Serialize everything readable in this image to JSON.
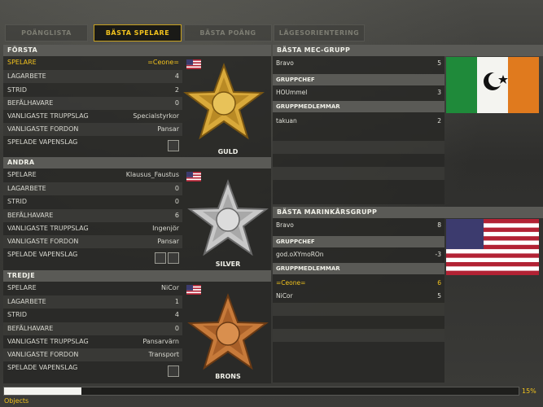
{
  "tabs": [
    {
      "label": "POÄNGLISTA",
      "active": false
    },
    {
      "label": "BÄSTA SPELARE",
      "active": true
    },
    {
      "label": "BÄSTA POÄNG",
      "active": false
    },
    {
      "label": "LÄGESORIENTERING",
      "active": false
    }
  ],
  "places": [
    {
      "title": "FÖRSTA",
      "rows": [
        {
          "k": "SPELARE",
          "v": "=Ceone=",
          "hl": true
        },
        {
          "k": "LAGARBETE",
          "v": "4"
        },
        {
          "k": "STRID",
          "v": "2"
        },
        {
          "k": "BEFÄLHAVARE",
          "v": "0"
        },
        {
          "k": "VANLIGASTE TRUPPSLAG",
          "v": "Specialstyrkor"
        },
        {
          "k": "VANLIGASTE FORDON",
          "v": "Pansar"
        },
        {
          "k": "SPELADE VAPENSLAG",
          "v": ""
        }
      ],
      "medal": "GULD",
      "medal_color": "#d9a93a"
    },
    {
      "title": "ANDRA",
      "rows": [
        {
          "k": "SPELARE",
          "v": "Klausus_Faustus"
        },
        {
          "k": "LAGARBETE",
          "v": "0"
        },
        {
          "k": "STRID",
          "v": "0"
        },
        {
          "k": "BEFÄLHAVARE",
          "v": "6"
        },
        {
          "k": "VANLIGASTE TRUPPSLAG",
          "v": "Ingenjör"
        },
        {
          "k": "VANLIGASTE FORDON",
          "v": "Pansar"
        },
        {
          "k": "SPELADE VAPENSLAG",
          "v": ""
        }
      ],
      "medal": "SILVER",
      "medal_color": "#c8c8c8"
    },
    {
      "title": "TREDJE",
      "rows": [
        {
          "k": "SPELARE",
          "v": "NiCor"
        },
        {
          "k": "LAGARBETE",
          "v": "1"
        },
        {
          "k": "STRID",
          "v": "4"
        },
        {
          "k": "BEFÄLHAVARE",
          "v": "0"
        },
        {
          "k": "VANLIGASTE TRUPPSLAG",
          "v": "Pansarvärn"
        },
        {
          "k": "VANLIGASTE FORDON",
          "v": "Transport"
        },
        {
          "k": "SPELADE VAPENSLAG",
          "v": ""
        }
      ],
      "medal": "BRONS",
      "medal_color": "#c77a3a"
    }
  ],
  "mec": {
    "title": "BÄSTA MEC-GRUPP",
    "squad": {
      "name": "Bravo",
      "val": "5"
    },
    "chef_label": "GRUPPCHEF",
    "chef": {
      "name": "HOUmmel",
      "val": "3"
    },
    "members_label": "GRUPPMEDLEMMAR",
    "members": [
      {
        "name": "takuan",
        "val": "2"
      }
    ]
  },
  "usmc": {
    "title": "BÄSTA MARINKÅRSGRUPP",
    "squad": {
      "name": "Bravo",
      "val": "8"
    },
    "chef_label": "GRUPPCHEF",
    "chef": {
      "name": "god.oXYmoROn",
      "val": "-3"
    },
    "members_label": "GRUPPMEDLEMMAR",
    "members": [
      {
        "name": "=Ceone=",
        "val": "6",
        "hl": true
      },
      {
        "name": "NiCor",
        "val": "5"
      }
    ]
  },
  "progress": {
    "percent_text": "15%",
    "value": 15
  },
  "status": "Objects",
  "colors": {
    "accent": "#f2c21d",
    "panel": "#282826",
    "header": "#5a5a56"
  }
}
